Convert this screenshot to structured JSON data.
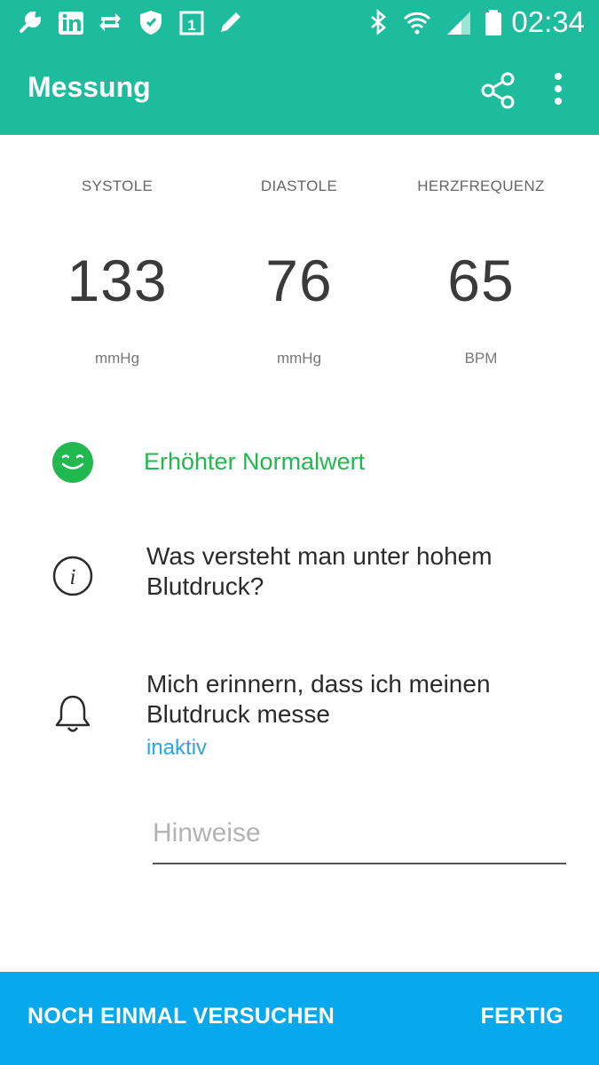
{
  "status_bar": {
    "time": "02:34",
    "left_icons": [
      "wrench-icon",
      "linkedin-icon",
      "sync-icon",
      "shield-icon",
      "calendar-icon",
      "pencil-icon"
    ],
    "right_icons": [
      "bluetooth-icon",
      "wifi-icon",
      "signal-icon",
      "battery-icon"
    ]
  },
  "app_bar": {
    "title": "Messung",
    "color": "#1dbc9c"
  },
  "metrics": [
    {
      "label": "SYSTOLE",
      "value": "133",
      "unit": "mmHg"
    },
    {
      "label": "DIASTOLE",
      "value": "76",
      "unit": "mmHg"
    },
    {
      "label": "HERZFREQUENZ",
      "value": "65",
      "unit": "BPM"
    }
  ],
  "status": {
    "text": "Erhöhter Normalwert",
    "color": "#21b84f"
  },
  "info": {
    "text_line1": "Was versteht man unter hohem",
    "text_line2": "Blutdruck?"
  },
  "reminder": {
    "text_line1": "Mich erinnern, dass ich meinen",
    "text_line2": "Blutdruck messe",
    "state": "inaktiv"
  },
  "notes": {
    "placeholder": "Hinweise",
    "value": ""
  },
  "bottom_bar": {
    "retry_label": "NOCH EINMAL VERSUCHEN",
    "done_label": "FERTIG",
    "color": "#08a8ec"
  }
}
